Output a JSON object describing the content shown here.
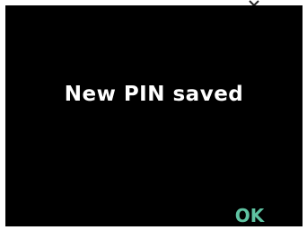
{
  "screen": {
    "message": "New PIN saved",
    "ok_label": "OK"
  },
  "colors": {
    "background": "#000000",
    "message_text": "#ffffff",
    "accent": "#5fc3a2"
  },
  "icons": {
    "top_indicator": "chevron-down-icon"
  }
}
